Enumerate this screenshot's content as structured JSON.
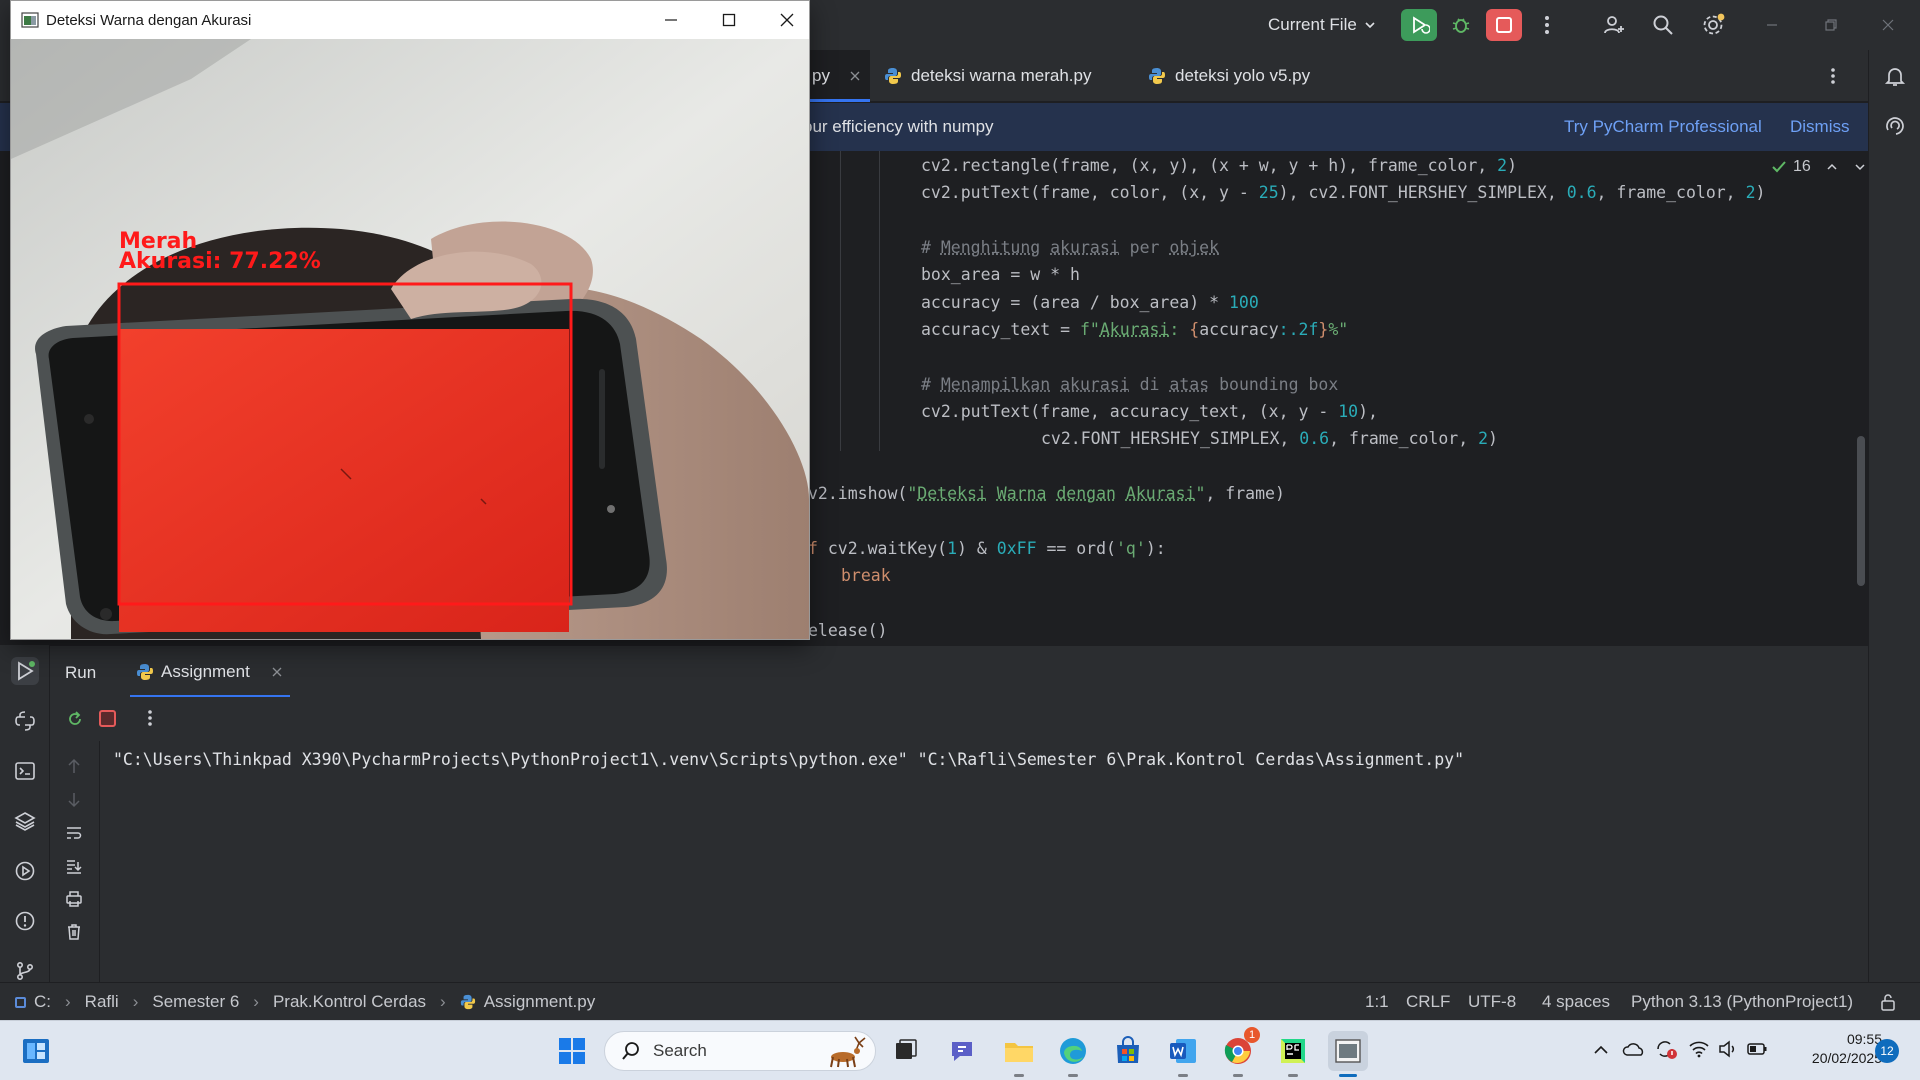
{
  "cv_window": {
    "title": "Deteksi Warna dengan Akurasi",
    "overlay_label": "Merah",
    "overlay_accuracy": "Akurasi: 77.22%"
  },
  "topbar": {
    "run_config": "Current File"
  },
  "tabs": [
    {
      "label": "py",
      "active": true
    },
    {
      "label": "deteksi warna merah.py",
      "active": false
    },
    {
      "label": "deteksi yolo v5.py",
      "active": false
    }
  ],
  "banner": {
    "message": "our efficiency with numpy",
    "action_primary": "Try PyCharm Professional",
    "action_dismiss": "Dismiss"
  },
  "editor": {
    "inspection_count": "16",
    "lines": [
      "cv2.rectangle(frame, (x, y), (x + w, y + h), frame_color, 2)",
      "cv2.putText(frame, color, (x, y - 25), cv2.FONT_HERSHEY_SIMPLEX, 0.6, frame_color, 2)",
      "# Menghitung akurasi per objek",
      "box_area = w * h",
      "accuracy = (area / box_area) * 100",
      "accuracy_text = f\"Akurasi: {accuracy:.2f}%\"",
      "# Menampilkan akurasi di atas bounding box",
      "cv2.putText(frame, accuracy_text, (x, y - 10),",
      "cv2.FONT_HERSHEY_SIMPLEX, 0.6, frame_color, 2)",
      "v2.imshow(\"Deteksi Warna dengan Akurasi\", frame)",
      "f cv2.waitKey(1) & 0xFF == ord('q'):",
      "break",
      "elease()"
    ]
  },
  "run_panel": {
    "tab_run": "Run",
    "tab_config": "Assignment",
    "console_output": "\"C:\\Users\\Thinkpad X390\\PycharmProjects\\PythonProject1\\.venv\\Scripts\\python.exe\" \"C:\\Rafli\\Semester 6\\Prak.Kontrol Cerdas\\Assignment.py\""
  },
  "statusbar": {
    "breadcrumb": [
      "C:",
      "Rafli",
      "Semester 6",
      "Prak.Kontrol Cerdas",
      "Assignment.py"
    ],
    "position": "1:1",
    "line_sep": "CRLF",
    "encoding": "UTF-8",
    "indent": "4 spaces",
    "interpreter": "Python 3.13 (PythonProject1)"
  },
  "taskbar": {
    "search_placeholder": "Search",
    "time": "09:55",
    "date": "20/02/2025",
    "notification_count": "12",
    "chrome_badge": "1"
  },
  "colors": {
    "accent": "#3574f0",
    "stop_button": "#e55a5a",
    "run_button": "#3d9b5b",
    "detection_red": "#ff1a1a"
  }
}
